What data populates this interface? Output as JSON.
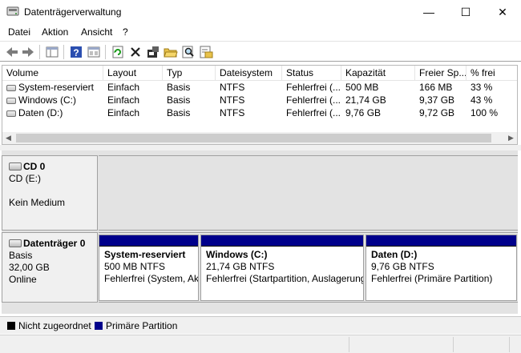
{
  "window": {
    "title": "Datenträgerverwaltung",
    "controls": [
      "—",
      "☐",
      "✕"
    ]
  },
  "menu": [
    "Datei",
    "Aktion",
    "Ansicht",
    "?"
  ],
  "toolbar_icons": [
    "back-icon",
    "forward-icon",
    "show-hide-console-icon",
    "help-icon",
    "properties-icon",
    "refresh-icon",
    "delete-icon",
    "settings-icon",
    "open-folder-icon",
    "search-icon",
    "export-icon"
  ],
  "volumes": {
    "columns": [
      "Volume",
      "Layout",
      "Typ",
      "Dateisystem",
      "Status",
      "Kapazität",
      "Freier Sp...",
      "% frei"
    ],
    "rows": [
      [
        "System-reserviert",
        "Einfach",
        "Basis",
        "NTFS",
        "Fehlerfrei (...",
        "500 MB",
        "166 MB",
        "33 %"
      ],
      [
        "Windows (C:)",
        "Einfach",
        "Basis",
        "NTFS",
        "Fehlerfrei (...",
        "21,74 GB",
        "9,37 GB",
        "43 %"
      ],
      [
        "Daten (D:)",
        "Einfach",
        "Basis",
        "NTFS",
        "Fehlerfrei (...",
        "9,76 GB",
        "9,72 GB",
        "100 %"
      ]
    ]
  },
  "disks": [
    {
      "name": "CD 0",
      "lines": [
        "CD (E:)",
        "",
        "Kein Medium"
      ]
    },
    {
      "name": "Datenträger 0",
      "lines": [
        "Basis",
        "32,00 GB",
        "Online"
      ],
      "partitions": [
        {
          "name": "System-reserviert",
          "size": "500 MB NTFS",
          "status": "Fehlerfrei (System, Akt"
        },
        {
          "name": "Windows  (C:)",
          "size": "21,74 GB NTFS",
          "status": "Fehlerfrei (Startpartition, Auslagerung"
        },
        {
          "name": "Daten  (D:)",
          "size": "9,76 GB NTFS",
          "status": "Fehlerfrei (Primäre Partition)"
        }
      ]
    }
  ],
  "legend": [
    {
      "label": "Nicht zugeordnet",
      "color": "#000000"
    },
    {
      "label": "Primäre Partition",
      "color": "#00008b"
    }
  ]
}
